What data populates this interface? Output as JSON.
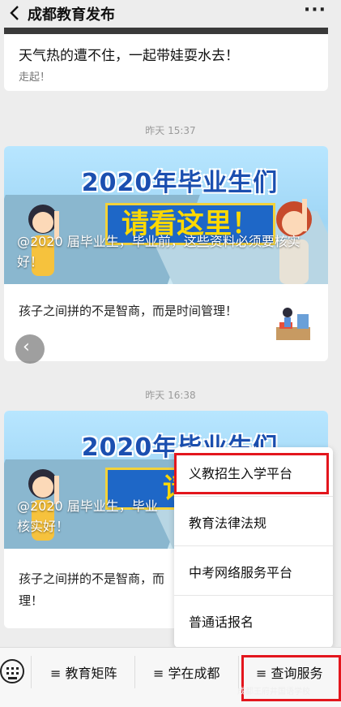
{
  "header": {
    "title": "成都教育发布",
    "more_label": "···"
  },
  "messages": [
    {
      "title": "天气热的遭不住，一起带娃耍水去！",
      "subtitle": "走起！"
    },
    {
      "time": "昨天 15:37",
      "banner_text": "2020年毕业生们",
      "sign_text": "请看这里！",
      "cover_title": "@2020 届毕业生，毕业前，这些资料必须要核实好！",
      "sub_title": "孩子之间拼的不是智商，而是时间管理！"
    },
    {
      "time": "昨天 16:38",
      "banner_text": "2020年毕业生们",
      "sign_text": "请看",
      "cover_title": "@2020 届毕业生，毕业",
      "cover_title_line2": "核实好！",
      "sub_title": "孩子之间拼的不是智商，而",
      "sub_title_line2": "理！"
    }
  ],
  "menu": {
    "items": [
      {
        "label": "义教招生入学平台"
      },
      {
        "label": "教育法律法规"
      },
      {
        "label": "中考网络服务平台"
      },
      {
        "label": "普通话报名"
      }
    ]
  },
  "bottom_nav": {
    "tabs": [
      {
        "label": "≡ 教育矩阵"
      },
      {
        "label": "≡ 学在成都"
      },
      {
        "label": "≡ 查询服务"
      }
    ]
  },
  "watermark": "成都王府井国语学校",
  "colors": {
    "highlight": "#e3161d",
    "background": "#ededed",
    "banner_blue": "#1e67c7",
    "sign_yellow": "#ffd900"
  },
  "icons": {
    "back": "chevron-left-icon",
    "more": "more-dots-icon",
    "keyboard": "keyboard-icon",
    "carousel_prev": "chevron-left-icon"
  }
}
